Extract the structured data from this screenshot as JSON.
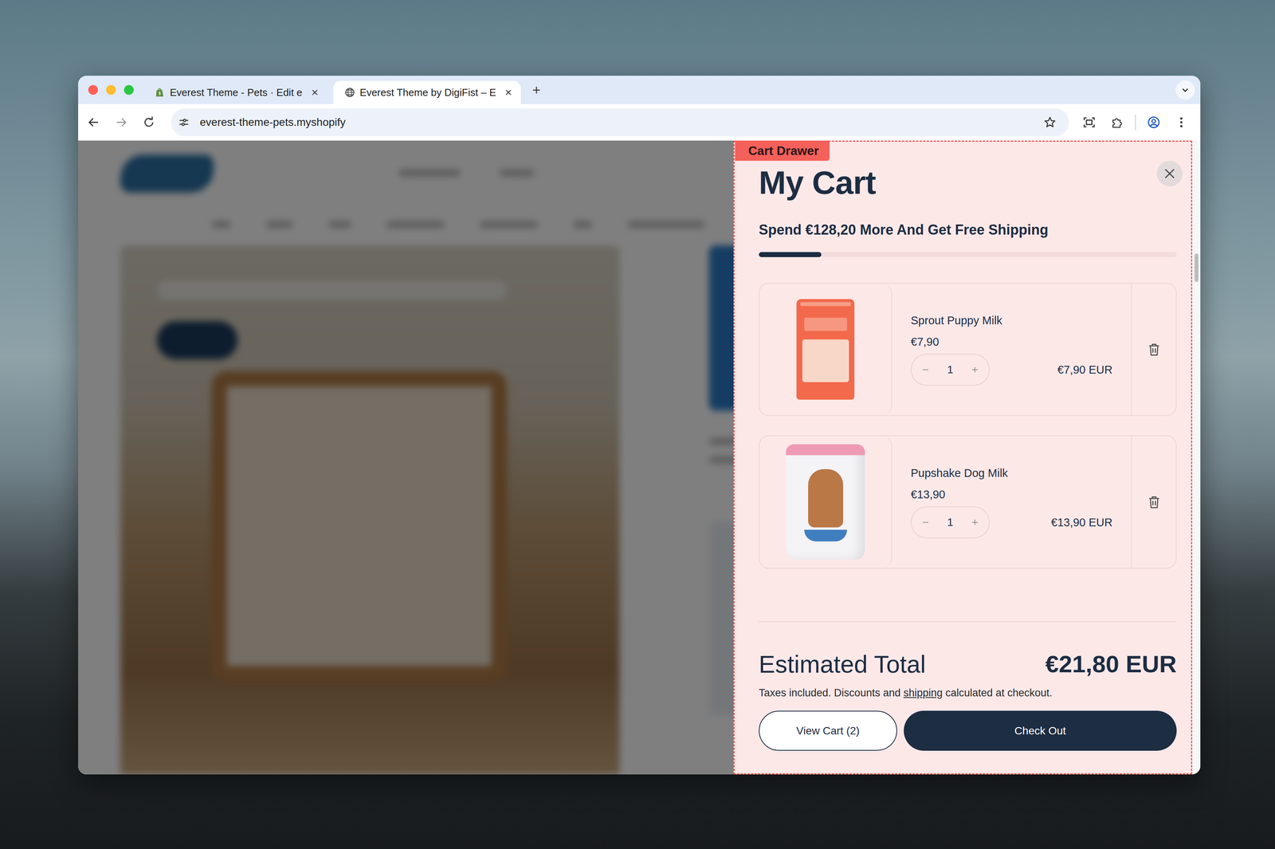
{
  "browser": {
    "tabs": [
      {
        "label": "Everest Theme - Pets · Edit e",
        "selected": false,
        "kind": "admin"
      },
      {
        "label": "Everest Theme by DigiFist – E",
        "selected": true,
        "kind": "site"
      }
    ],
    "url": "everest-theme-pets.myshopify"
  },
  "cart": {
    "badge": "Cart Drawer",
    "title": "My Cart",
    "shipping_message": "Spend €128,20 More And Get Free Shipping",
    "shipping_level": 0.15,
    "items": [
      {
        "name": "Sprout Puppy Milk",
        "price": "€7,90",
        "quantity": "1",
        "line_total": "€7,90 EUR",
        "kind": "bag",
        "color": "#f26a4b"
      },
      {
        "name": "Pupshake Dog Milk",
        "price": "€13,90",
        "quantity": "1",
        "line_total": "€13,90 EUR",
        "kind": "tin",
        "color": "#f4f3f6"
      }
    ],
    "total_label": "Estimated Total",
    "total": "€21,80 EUR",
    "note_before": "Taxes included. Discounts and ",
    "note_link": "shipping",
    "note_after": " calculated at checkout.",
    "buttons": [
      {
        "label": "View Cart (2)",
        "kind": "secondary"
      },
      {
        "label": "Check Out",
        "kind": "primary"
      }
    ]
  }
}
